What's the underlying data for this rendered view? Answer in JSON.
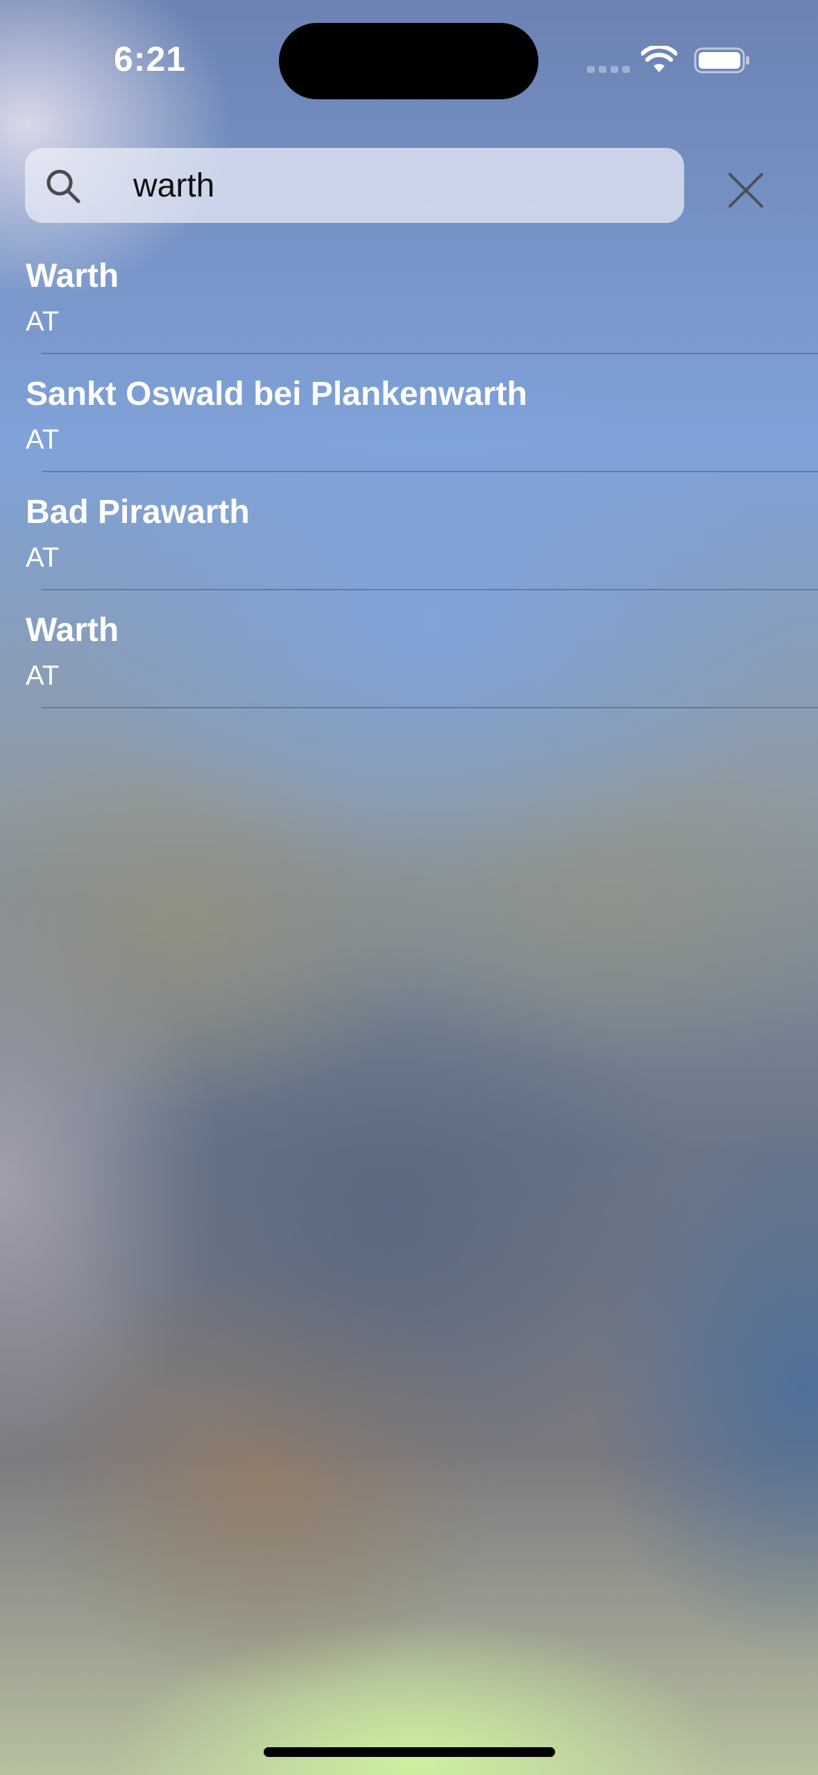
{
  "status_bar": {
    "time": "6:21",
    "icons": [
      "cellular-signal-icon",
      "wifi-icon",
      "battery-icon"
    ]
  },
  "search": {
    "icon": "search-icon",
    "value": "warth",
    "clear_icon": "close-icon"
  },
  "results": [
    {
      "name": "Warth",
      "country": "AT"
    },
    {
      "name": "Sankt Oswald bei Plankenwarth",
      "country": "AT"
    },
    {
      "name": "Bad Pirawarth",
      "country": "AT"
    },
    {
      "name": "Warth",
      "country": "AT"
    }
  ],
  "colors": {
    "text": "#ffffff",
    "search_field_bg": "#e6e9f4"
  }
}
